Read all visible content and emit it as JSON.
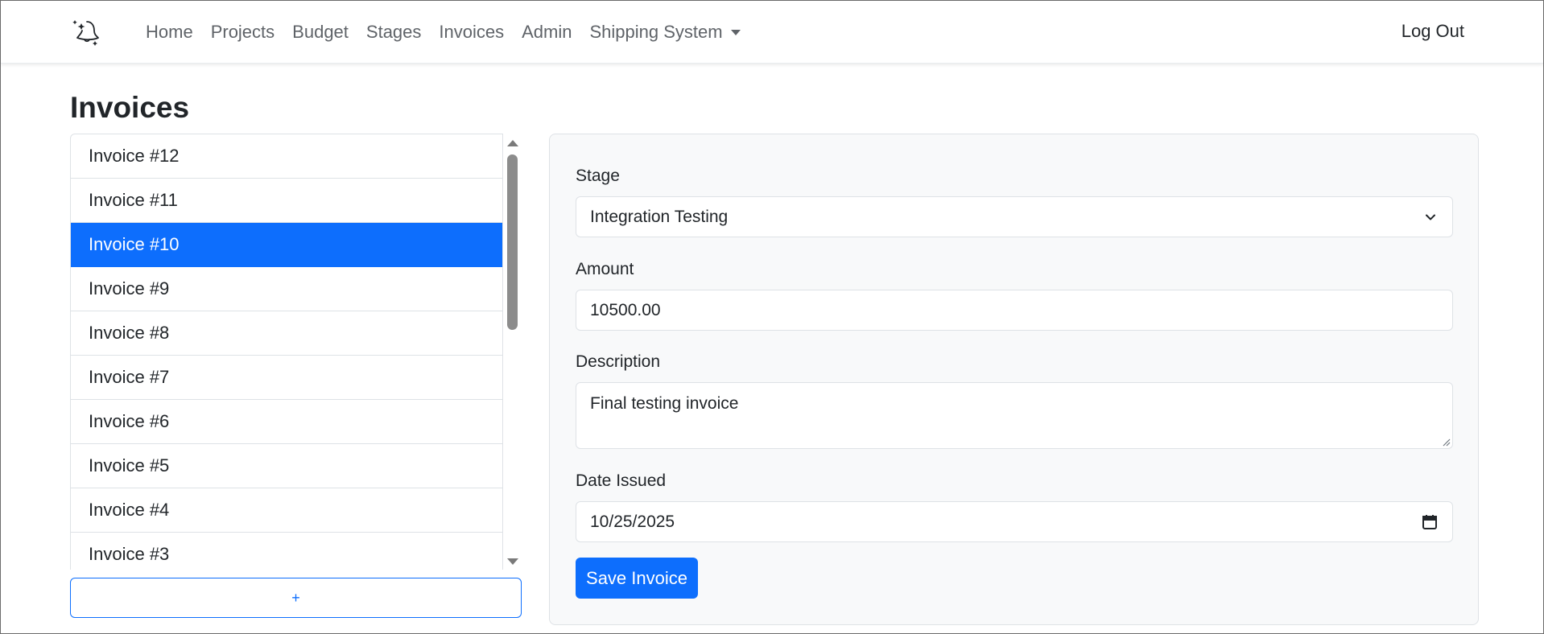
{
  "nav": {
    "brand_icon": "bell-sparkle-icon",
    "links": [
      {
        "label": "Home"
      },
      {
        "label": "Projects"
      },
      {
        "label": "Budget"
      },
      {
        "label": "Stages"
      },
      {
        "label": "Invoices"
      },
      {
        "label": "Admin"
      }
    ],
    "dropdown_label": "Shipping System",
    "logout_label": "Log Out"
  },
  "page": {
    "title": "Invoices"
  },
  "invoice_list": {
    "items": [
      {
        "label": "Invoice #12",
        "active": false
      },
      {
        "label": "Invoice #11",
        "active": false
      },
      {
        "label": "Invoice #10",
        "active": true
      },
      {
        "label": "Invoice #9",
        "active": false
      },
      {
        "label": "Invoice #8",
        "active": false
      },
      {
        "label": "Invoice #7",
        "active": false
      },
      {
        "label": "Invoice #6",
        "active": false
      },
      {
        "label": "Invoice #5",
        "active": false
      },
      {
        "label": "Invoice #4",
        "active": false
      },
      {
        "label": "Invoice #3",
        "active": false
      }
    ],
    "add_label": "+"
  },
  "form": {
    "stage_label": "Stage",
    "stage_value": "Integration Testing",
    "amount_label": "Amount",
    "amount_value": "10500.00",
    "description_label": "Description",
    "description_value": "Final testing invoice",
    "date_label": "Date Issued",
    "date_value": "10/25/2025",
    "save_label": "Save Invoice"
  },
  "colors": {
    "primary": "#0d6efd",
    "card_bg": "#f8f9fa",
    "border": "#dee2e6"
  }
}
